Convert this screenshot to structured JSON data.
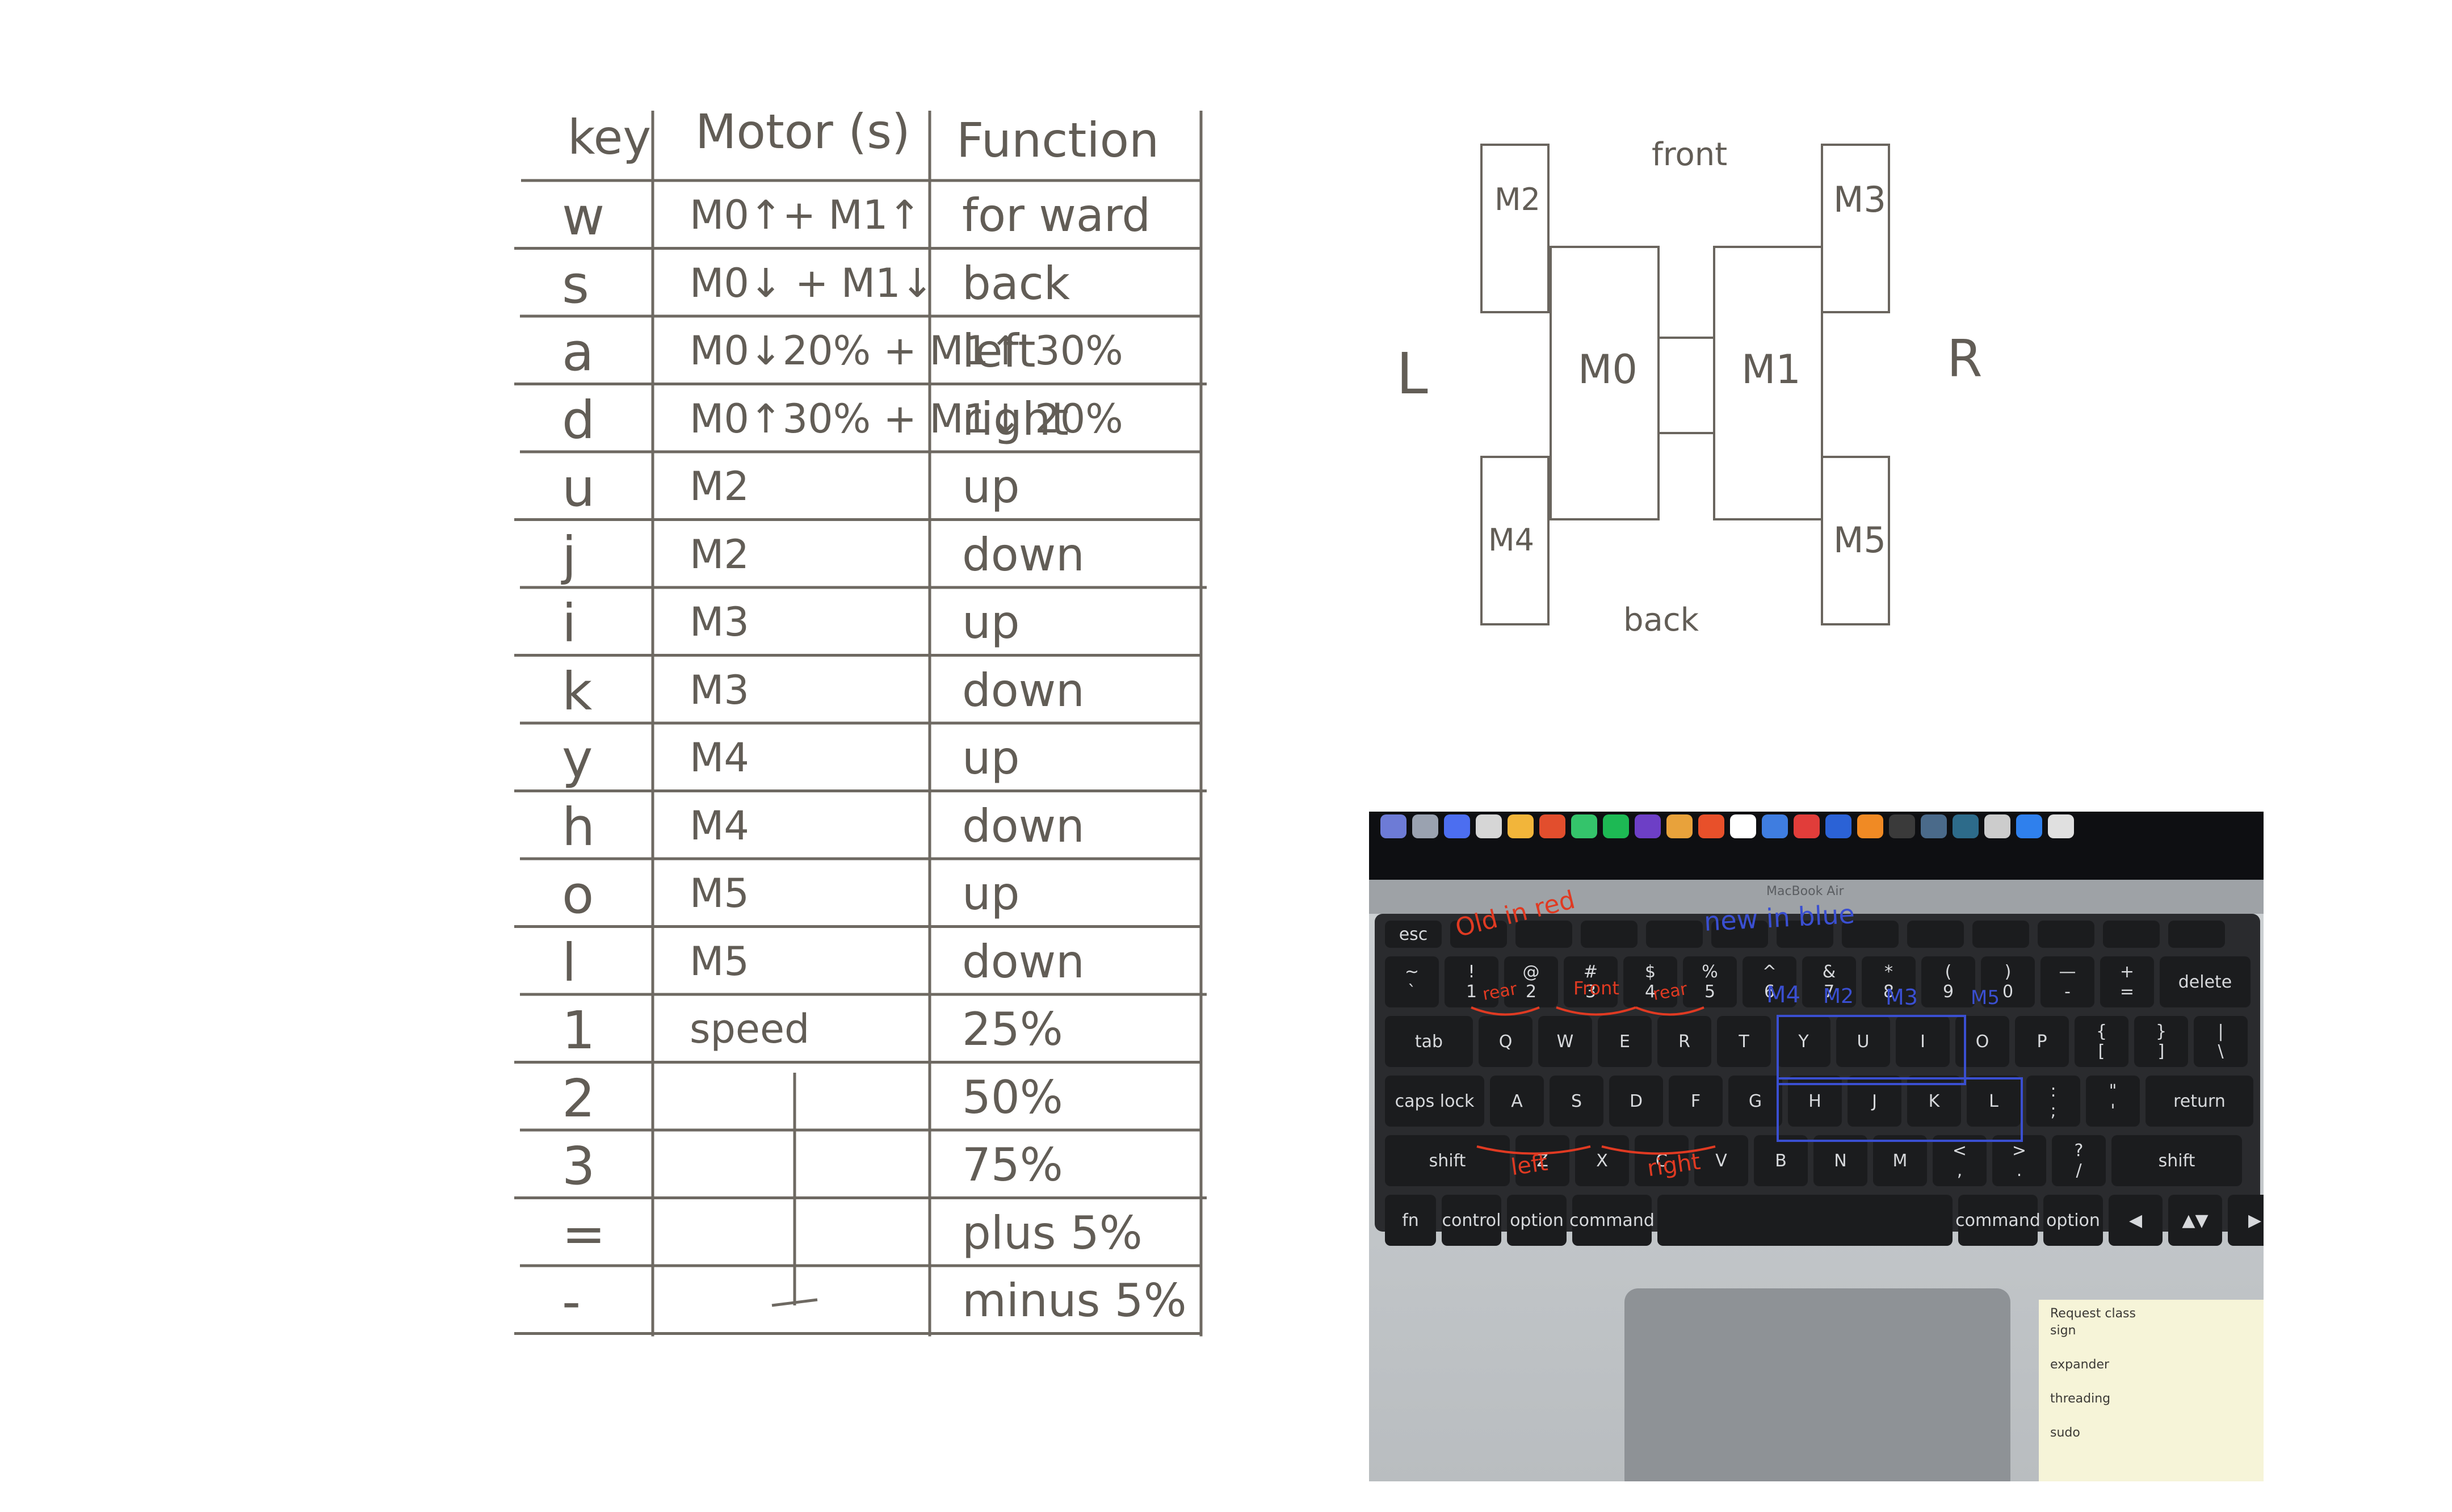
{
  "table": {
    "headers": {
      "key": "key",
      "motor": "Motor (s)",
      "function": "Function"
    },
    "rows": [
      {
        "key": "w",
        "motor": "M0↑+ M1↑",
        "function": "for ward"
      },
      {
        "key": "s",
        "motor": "M0↓ + M1↓",
        "function": "back"
      },
      {
        "key": "a",
        "motor": "M0↓20% + M1↑ 30%",
        "function": "left"
      },
      {
        "key": "d",
        "motor": "M0↑30% + M1↓ 20%",
        "function": "right"
      },
      {
        "key": "u",
        "motor": "M2",
        "function": "up"
      },
      {
        "key": "j",
        "motor": "M2",
        "function": "down"
      },
      {
        "key": "i",
        "motor": "M3",
        "function": "up"
      },
      {
        "key": "k",
        "motor": "M3",
        "function": "down"
      },
      {
        "key": "y",
        "motor": "M4",
        "function": "up"
      },
      {
        "key": "h",
        "motor": "M4",
        "function": "down"
      },
      {
        "key": "o",
        "motor": "M5",
        "function": "up"
      },
      {
        "key": "l",
        "motor": "M5",
        "function": "down"
      },
      {
        "key": "1",
        "motor": "speed",
        "function": "25%"
      },
      {
        "key": "2",
        "motor": "",
        "function": "50%"
      },
      {
        "key": "3",
        "motor": "",
        "function": "75%"
      },
      {
        "key": "=",
        "motor": "",
        "function": "plus 5%"
      },
      {
        "key": "-",
        "motor": "",
        "function": "minus 5%"
      }
    ]
  },
  "diagram": {
    "front": "front",
    "back": "back",
    "left": "L",
    "right": "R",
    "m0": "M0",
    "m1": "M1",
    "m2": "M2",
    "m3": "M3",
    "m4": "M4",
    "m5": "M5"
  },
  "photo": {
    "laptop_label": "MacBook Air",
    "old_note": "Old in red",
    "new_note": "new in blue",
    "red_rear_1": "rear",
    "red_front": "Front",
    "red_rear_2": "rear",
    "red_left": "left",
    "red_right": "right",
    "blue_m4": "M4",
    "blue_m2": "M2",
    "blue_m3": "M3",
    "blue_m5": "M5",
    "sticky_lines": [
      "Request class",
      "sign",
      "",
      "expander",
      "",
      "threading",
      "",
      "sudo"
    ],
    "keys_fn": [
      "esc",
      "",
      "",
      "",
      "",
      "",
      "",
      "",
      "",
      "",
      "",
      "",
      ""
    ],
    "keys_num": [
      "~\n`",
      "!\n1",
      "@\n2",
      "#\n3",
      "$\n4",
      "%\n5",
      "^\n6",
      "&\n7",
      "*\n8",
      "(\n9",
      ")\n0",
      "—\n-",
      "+\n=",
      "delete"
    ],
    "keys_q": [
      "tab",
      "Q",
      "W",
      "E",
      "R",
      "T",
      "Y",
      "U",
      "I",
      "O",
      "P",
      "{\n[",
      "}\n]",
      "|\n\\"
    ],
    "keys_a": [
      "caps lock",
      "A",
      "S",
      "D",
      "F",
      "G",
      "H",
      "J",
      "K",
      "L",
      ":\n;",
      "\"\n'",
      "return"
    ],
    "keys_z": [
      "shift",
      "Z",
      "X",
      "C",
      "V",
      "B",
      "N",
      "M",
      "<\n,",
      ">\n.",
      "?\n/",
      "shift"
    ],
    "keys_bottom": [
      "fn",
      "control",
      "option",
      "command",
      "",
      "command",
      "option",
      "◀",
      "▲▼",
      "▶"
    ]
  },
  "colors": {
    "ink": "#625d56",
    "red_ink": "#e03a22",
    "blue_ink": "#3a4fd1",
    "sticky": "#f6f4d8"
  }
}
